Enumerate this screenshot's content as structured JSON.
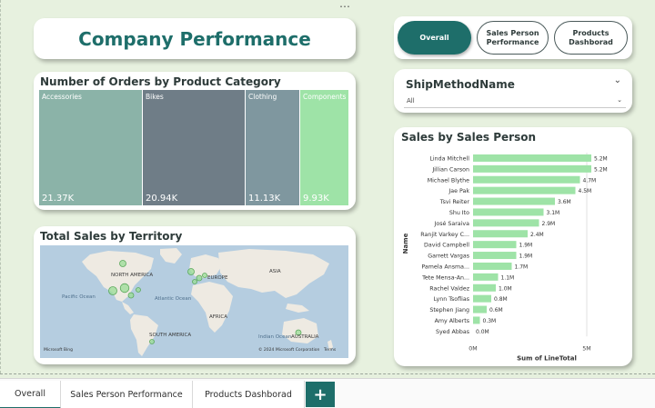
{
  "header": {
    "title": "Company Performance",
    "more_icon": "ellipsis-icon"
  },
  "nav_buttons": {
    "overall": "Overall",
    "sales_person_performance": "Sales Person\nPerformance",
    "products_dashboard": "Products\nDashborad"
  },
  "treemap": {
    "title": "Number of Orders by Product Category",
    "tiles": [
      {
        "label": "Accessories",
        "value": "21.37K",
        "color": "#8bb3a8"
      },
      {
        "label": "Bikes",
        "value": "20.94K",
        "color": "#6f7d87"
      },
      {
        "label": "Clothing",
        "value": "11.13K",
        "color": "#7f979f"
      },
      {
        "label": "Components",
        "value": "9.93K",
        "color": "#9ee3a7"
      }
    ]
  },
  "map": {
    "title": "Total Sales by Territory",
    "labels": [
      "NORTH AMERICA",
      "EUROPE",
      "ASIA",
      "AFRICA",
      "SOUTH AMERICA",
      "AUSTRALIA"
    ],
    "oceans": [
      "Pacific Ocean",
      "Atlantic Ocean",
      "Indian Ocean"
    ],
    "attribution_left": "Microsoft Bing",
    "attribution_right": "© 2024 Microsoft Corporation",
    "terms": "Terms"
  },
  "slicer": {
    "title": "ShipMethodName",
    "selected": "All"
  },
  "bar_chart": {
    "title": "Sales by Sales Person",
    "xlabel": "Sum of LineTotal",
    "ylabel": "Name",
    "x_ticks": [
      "0M",
      "5M"
    ]
  },
  "chart_data": {
    "type": "bar",
    "orientation": "horizontal",
    "title": "Sales by Sales Person",
    "xlabel": "Sum of LineTotal",
    "ylabel": "Name",
    "categories": [
      "Linda Mitchell",
      "Jillian Carson",
      "Michael Blythe",
      "Jae Pak",
      "Tsvi Reiter",
      "Shu Ito",
      "José Saraiva",
      "Ranjit Varkey C...",
      "David Campbell",
      "Garrett Vargas",
      "Pamela Ansma...",
      "Tete Mensa-An...",
      "Rachel Valdez",
      "Lynn Tsoflias",
      "Stephen Jiang",
      "Amy Alberts",
      "Syed Abbas"
    ],
    "values": [
      5.2,
      5.2,
      4.7,
      4.5,
      3.6,
      3.1,
      2.9,
      2.4,
      1.9,
      1.9,
      1.7,
      1.1,
      1.0,
      0.8,
      0.6,
      0.3,
      0.0
    ],
    "labels": [
      "5.2M",
      "5.2M",
      "4.7M",
      "4.5M",
      "3.6M",
      "3.1M",
      "2.9M",
      "2.4M",
      "1.9M",
      "1.9M",
      "1.7M",
      "1.1M",
      "1.0M",
      "0.8M",
      "0.6M",
      "0.3M",
      "0.0M"
    ],
    "unit": "M",
    "xlim": [
      0,
      5.6
    ],
    "bar_color": "#9ee3a7"
  },
  "tabs": {
    "items": [
      "Overall",
      "Sales Person Performance",
      "Products Dashborad"
    ],
    "add_label": "+"
  },
  "colors": {
    "accent": "#1e6e6a",
    "canvas": "#e7f1df"
  }
}
